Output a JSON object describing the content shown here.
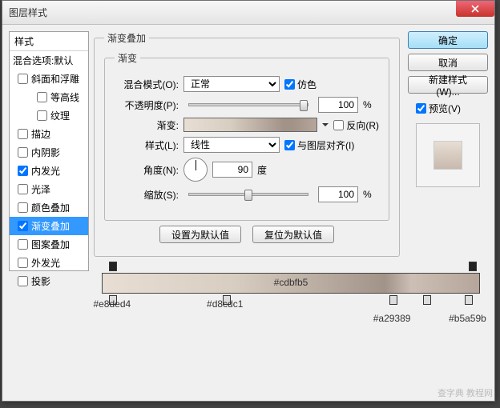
{
  "window": {
    "title": "图层样式"
  },
  "sidebar": {
    "header": "样式",
    "blend": "混合选项:默认",
    "items": [
      {
        "label": "斜面和浮雕",
        "checked": false,
        "selected": false,
        "sub": [
          {
            "label": "等高线",
            "checked": false
          },
          {
            "label": "纹理",
            "checked": false
          }
        ]
      },
      {
        "label": "描边",
        "checked": false,
        "selected": false
      },
      {
        "label": "内阴影",
        "checked": false,
        "selected": false
      },
      {
        "label": "内发光",
        "checked": true,
        "selected": false
      },
      {
        "label": "光泽",
        "checked": false,
        "selected": false
      },
      {
        "label": "颜色叠加",
        "checked": false,
        "selected": false
      },
      {
        "label": "渐变叠加",
        "checked": true,
        "selected": true
      },
      {
        "label": "图案叠加",
        "checked": false,
        "selected": false
      },
      {
        "label": "外发光",
        "checked": false,
        "selected": false
      },
      {
        "label": "投影",
        "checked": false,
        "selected": false
      }
    ]
  },
  "panel": {
    "group_title": "渐变叠加",
    "sub_title": "渐变",
    "blend_label": "混合模式(O):",
    "blend_value": "正常",
    "dither_label": "仿色",
    "dither": true,
    "opacity_label": "不透明度(P):",
    "opacity": "100",
    "opacity_unit": "%",
    "gradient_label": "渐变:",
    "reverse_label": "反向(R)",
    "reverse": false,
    "style_label": "样式(L):",
    "style_value": "线性",
    "align_label": "与图层对齐(I)",
    "align": true,
    "angle_label": "角度(N):",
    "angle": "90",
    "angle_unit": "度",
    "scale_label": "缩放(S):",
    "scale": "100",
    "scale_unit": "%",
    "reset_default": "设置为默认值",
    "restore_default": "复位为默认值"
  },
  "right": {
    "ok": "确定",
    "cancel": "取消",
    "new_style": "新建样式(W)...",
    "preview_label": "预览(V)",
    "preview": true
  },
  "gradient": {
    "center": "#cdbfb5",
    "bottom_stops": [
      {
        "pos": 2,
        "label": "#e8ded4"
      },
      {
        "pos": 32,
        "label": "#d8cdc1"
      },
      {
        "pos": 76,
        "label": "#a29389",
        "low": true
      },
      {
        "pos": 85,
        "label": "",
        "low": false
      },
      {
        "pos": 96,
        "label": "#b5a59b",
        "low": true
      }
    ],
    "top_stops": [
      {
        "pos": 2
      },
      {
        "pos": 97
      }
    ]
  },
  "watermark": "查字典  教程网"
}
